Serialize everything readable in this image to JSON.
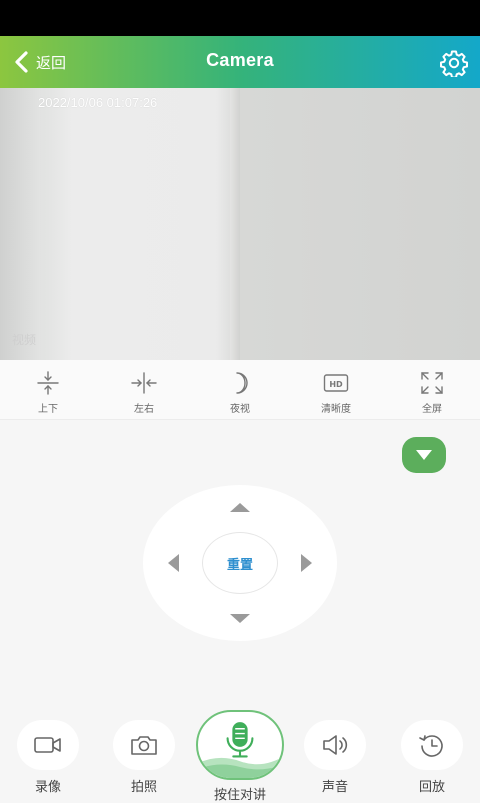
{
  "header": {
    "back_label": "返回",
    "title": "Camera",
    "settings_icon": "gear-icon"
  },
  "video": {
    "timestamp": "2022/10/06 01:07:26",
    "watermark": "视频"
  },
  "toolbar": {
    "items": [
      {
        "label": "上下",
        "icon": "flip-vertical-icon"
      },
      {
        "label": "左右",
        "icon": "flip-horizontal-icon"
      },
      {
        "label": "夜视",
        "icon": "moon-icon"
      },
      {
        "label": "清晰度",
        "icon": "hd-icon"
      },
      {
        "label": "全屏",
        "icon": "fullscreen-icon"
      }
    ],
    "hd_text": "HD"
  },
  "ptz": {
    "reset_label": "重置"
  },
  "bottom": {
    "record_label": "录像",
    "snapshot_label": "拍照",
    "talk_label": "按住对讲",
    "sound_label": "声音",
    "playback_label": "回放"
  },
  "colors": {
    "accent_green": "#5cae5c",
    "reset_blue": "#2e8fcf",
    "header_gradient_start": "#8cc63f",
    "header_gradient_end": "#14a8c9"
  }
}
